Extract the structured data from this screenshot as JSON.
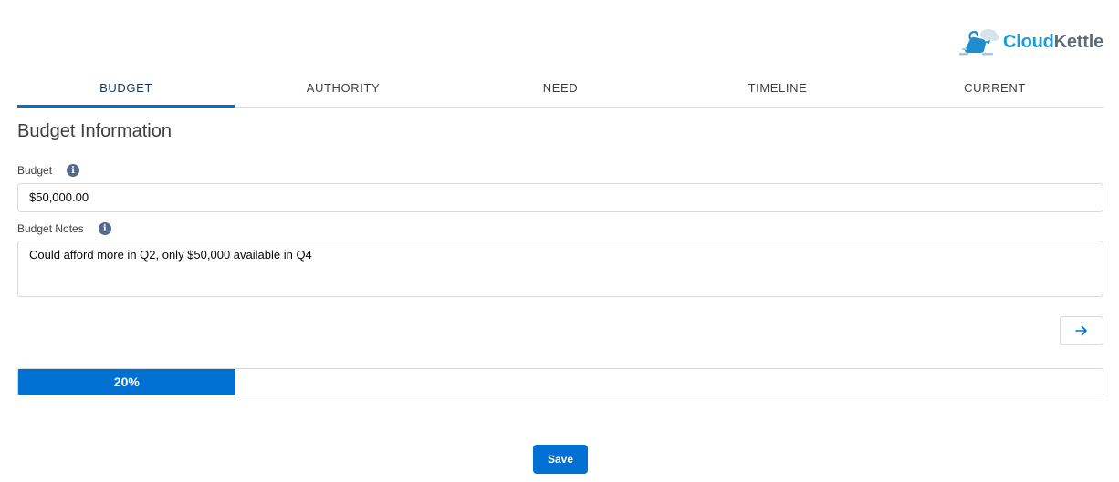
{
  "logo": {
    "text_part1": "Cloud",
    "text_part2": "Kettle",
    "icon": "cloudkettle-logo-icon"
  },
  "tabs": [
    {
      "label": "BUDGET",
      "active": true
    },
    {
      "label": "AUTHORITY",
      "active": false
    },
    {
      "label": "NEED",
      "active": false
    },
    {
      "label": "TIMELINE",
      "active": false
    },
    {
      "label": "CURRENT",
      "active": false
    }
  ],
  "section": {
    "title": "Budget Information"
  },
  "fields": {
    "budget": {
      "label": "Budget",
      "value": "$50,000.00",
      "info_icon": "info-icon"
    },
    "budget_notes": {
      "label": "Budget Notes",
      "value": "Could afford more in Q2, only $50,000 available in Q4",
      "info_icon": "info-icon"
    }
  },
  "navigation": {
    "next_icon": "arrow-right-icon"
  },
  "progress": {
    "percent": 20,
    "label": "20%"
  },
  "actions": {
    "save_label": "Save"
  },
  "colors": {
    "accent": "#0070d2",
    "logo_cloud": "#1d9bd6",
    "logo_kettle": "#5f6b75"
  }
}
